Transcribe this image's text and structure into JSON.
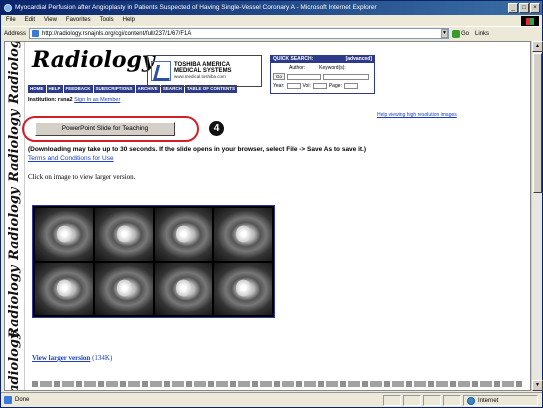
{
  "window": {
    "title": "Myocardial Perfusion after Angioplasty in Patients Suspected of Having Single-Vessel Coronary A - Microsoft Internet Explorer",
    "min": "_",
    "max": "□",
    "close": "×"
  },
  "menu": [
    "File",
    "Edit",
    "View",
    "Favorites",
    "Tools",
    "Help"
  ],
  "address": {
    "label": "Address",
    "url": "http://radiology.rsnajnls.org/cgi/content/full/237/1/67/F1A",
    "go": "Go",
    "links": "Links"
  },
  "sidebar_word": "Radiology",
  "site": {
    "logo": "Radiology",
    "nav": [
      "HOME",
      "HELP",
      "FEEDBACK",
      "SUBSCRIPTIONS",
      "ARCHIVE",
      "SEARCH",
      "TABLE OF CONTENTS"
    ],
    "ad": {
      "line1": "TOSHIBA AMERICA",
      "line2": "MEDICAL SYSTEMS",
      "url": "www.medical.toshiba.com"
    },
    "quick_search": {
      "title": "QUICK SEARCH:",
      "advanced": "[advanced]",
      "author_label": "Author:",
      "keyword_label": "Keyword(s):",
      "go": "Go",
      "year_label": "Year:",
      "vol_label": "Vol:",
      "page_label": "Page:"
    },
    "institution_label": "Institution: rsna2",
    "sign_in": "Sign In as Member"
  },
  "ppt_button": "PowerPoint Slide for Teaching",
  "callout_number": "4",
  "help_link": "Help viewing high resolution images",
  "download_note": "(Downloading may take up to 30 seconds. If the slide opens in your browser, select File -> Save As to save it.)",
  "terms_link": "Terms and Conditions for Use",
  "click_note": "Click on image to view larger version.",
  "view_larger": {
    "link": "View larger version",
    "size": " (134K)"
  },
  "status": {
    "left": "Done",
    "zone": "Internet"
  }
}
